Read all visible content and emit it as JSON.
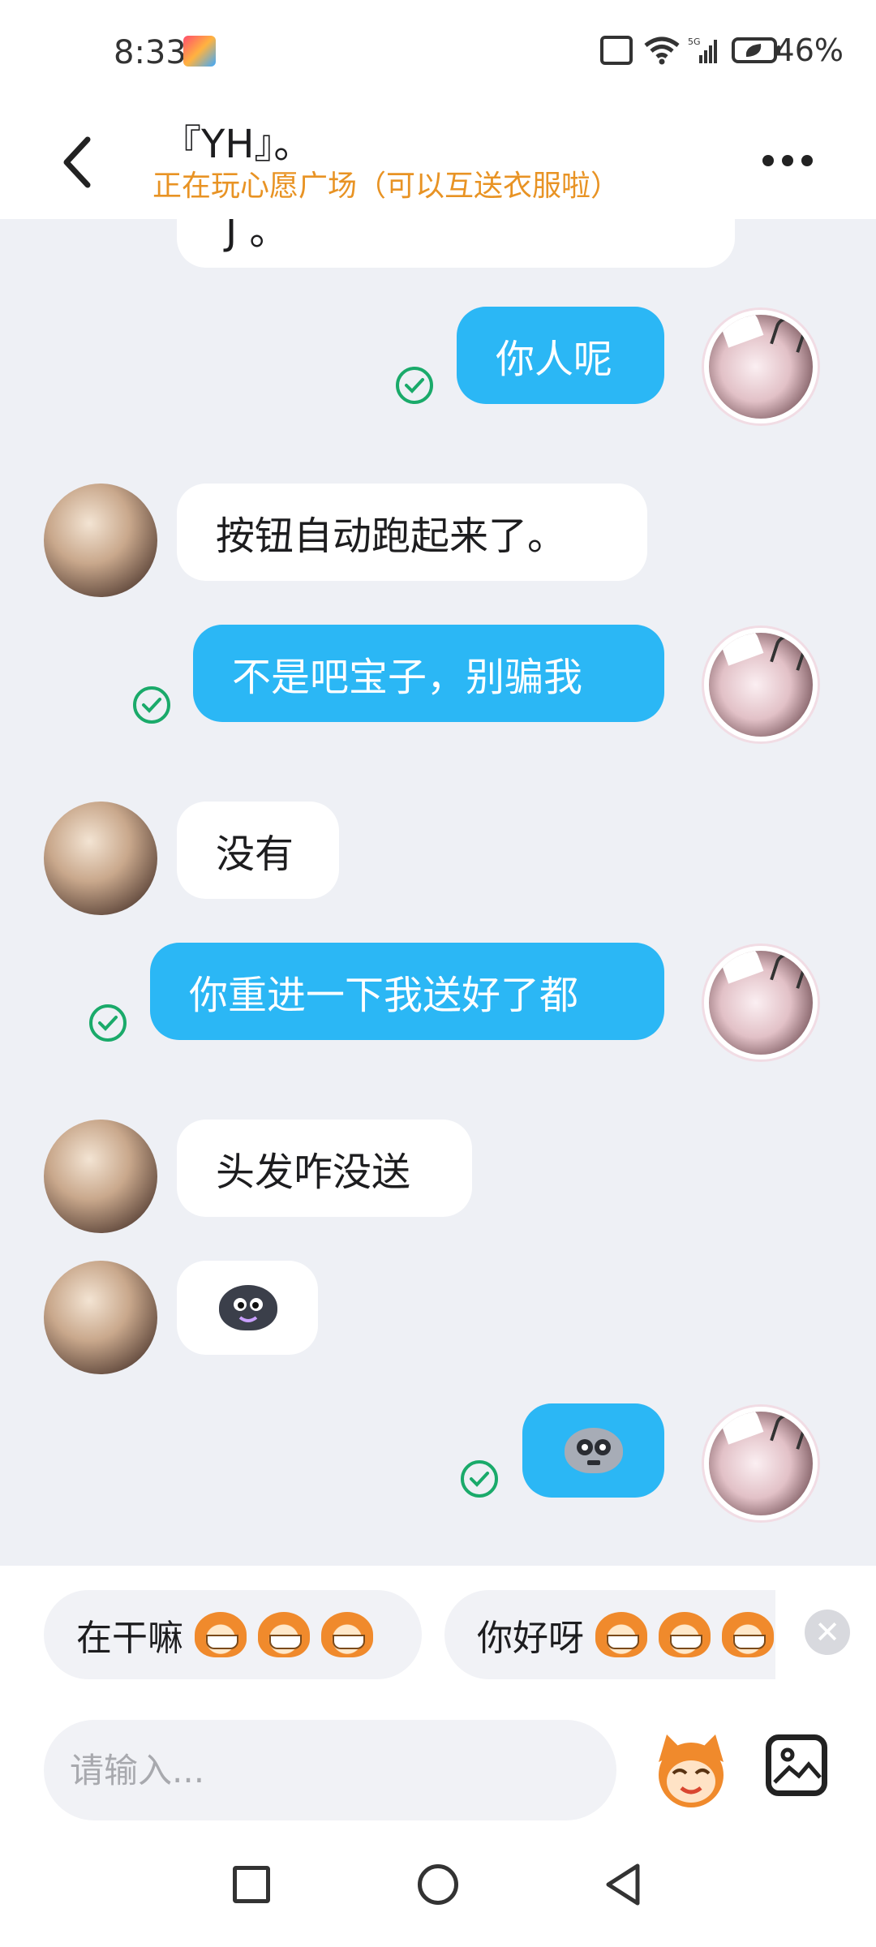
{
  "status_bar": {
    "time": "8:33",
    "battery": "46%",
    "network": "5G"
  },
  "header": {
    "title": "『YH』。",
    "subtitle": "正在玩心愿广场（可以互送衣服啦）"
  },
  "messages": [
    {
      "side": "in",
      "text": "J 。",
      "partial": true
    },
    {
      "side": "out",
      "text": "你人呢",
      "status": "read"
    },
    {
      "side": "in",
      "text": "按钮自动跑起来了。"
    },
    {
      "side": "out",
      "text": "不是吧宝子，别骗我",
      "status": "read"
    },
    {
      "side": "in",
      "text": "没有"
    },
    {
      "side": "out",
      "text": "你重进一下我送好了都",
      "status": "read"
    },
    {
      "side": "in",
      "text": "头发咋没送"
    },
    {
      "side": "in",
      "sticker": "dark-blob-face-sticker"
    },
    {
      "side": "out",
      "sticker": "grey-skull-face-sticker",
      "status": "read"
    }
  ],
  "quick_replies": [
    {
      "text": "在干嘛",
      "emoji": "grinning-monkey-emoji"
    },
    {
      "text": "你好呀",
      "emoji": "wide-eyed-monkey-emoji"
    }
  ],
  "input": {
    "placeholder": "请输入..."
  },
  "colors": {
    "accent": "#2bb7f5",
    "subtitle": "#e89324",
    "read_check": "#1aaa6a",
    "chat_bg": "#eef0f5"
  }
}
